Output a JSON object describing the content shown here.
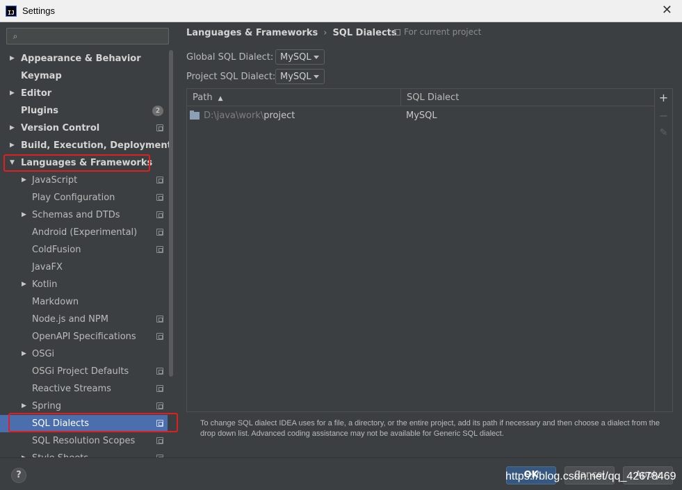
{
  "window": {
    "title": "Settings",
    "close_glyph": "✕",
    "app_icon_text": "IJ"
  },
  "search": {
    "placeholder": "",
    "value": "",
    "icon": "search-icon"
  },
  "tree": {
    "items": [
      {
        "label": "Appearance & Behavior",
        "level": 0,
        "arrow": "▶"
      },
      {
        "label": "Keymap",
        "level": 0,
        "arrow": ""
      },
      {
        "label": "Editor",
        "level": 0,
        "arrow": "▶"
      },
      {
        "label": "Plugins",
        "level": 0,
        "arrow": "",
        "badge": "2"
      },
      {
        "label": "Version Control",
        "level": 0,
        "arrow": "▶",
        "project": true
      },
      {
        "label": "Build, Execution, Deployment",
        "level": 0,
        "arrow": "▶"
      },
      {
        "label": "Languages & Frameworks",
        "level": 0,
        "arrow": "▼"
      },
      {
        "label": "JavaScript",
        "level": 1,
        "arrow": "▶",
        "project": true
      },
      {
        "label": "Play Configuration",
        "level": 1,
        "arrow": "",
        "project": true
      },
      {
        "label": "Schemas and DTDs",
        "level": 1,
        "arrow": "▶",
        "project": true
      },
      {
        "label": "Android (Experimental)",
        "level": 1,
        "arrow": "",
        "project": true
      },
      {
        "label": "ColdFusion",
        "level": 1,
        "arrow": "",
        "project": true
      },
      {
        "label": "JavaFX",
        "level": 1,
        "arrow": ""
      },
      {
        "label": "Kotlin",
        "level": 1,
        "arrow": "▶"
      },
      {
        "label": "Markdown",
        "level": 1,
        "arrow": ""
      },
      {
        "label": "Node.js and NPM",
        "level": 1,
        "arrow": "",
        "project": true
      },
      {
        "label": "OpenAPI Specifications",
        "level": 1,
        "arrow": "",
        "project": true
      },
      {
        "label": "OSGi",
        "level": 1,
        "arrow": "▶"
      },
      {
        "label": "OSGi Project Defaults",
        "level": 1,
        "arrow": "",
        "project": true
      },
      {
        "label": "Reactive Streams",
        "level": 1,
        "arrow": "",
        "project": true
      },
      {
        "label": "Spring",
        "level": 1,
        "arrow": "▶",
        "project": true
      },
      {
        "label": "SQL Dialects",
        "level": 1,
        "arrow": "",
        "project": true,
        "selected": true
      },
      {
        "label": "SQL Resolution Scopes",
        "level": 1,
        "arrow": "",
        "project": true
      },
      {
        "label": "Style Sheets",
        "level": 1,
        "arrow": "▶",
        "project": true
      }
    ]
  },
  "breadcrumb": {
    "parent": "Languages & Frameworks",
    "separator": "›",
    "current": "SQL Dialects"
  },
  "scope_note": "For current project",
  "global_dialect": {
    "label": "Global SQL Dialect:",
    "value": "MySQL"
  },
  "project_dialect": {
    "label": "Project SQL Dialect:",
    "value": "MySQL"
  },
  "table": {
    "columns": {
      "path": "Path",
      "dialect": "SQL Dialect",
      "sort_glyph": "▲"
    },
    "rows": [
      {
        "path_prefix": "D:\\java\\work\\",
        "path_name": "project",
        "dialect": "MySQL"
      }
    ]
  },
  "toolbar": {
    "add": "+",
    "remove": "−",
    "edit": "✎"
  },
  "hint": "To change SQL dialect IDEA uses for a file, a directory, or the entire project, add its path if necessary and then choose a dialect from the drop down list. Advanced coding assistance may not be available for Generic SQL dialect.",
  "footer": {
    "help": "?",
    "ok": "OK",
    "cancel": "Cancel",
    "apply": "Apply",
    "watermark": "https://blog.csdn.net/qq_42678469"
  },
  "colors": {
    "selection": "#4b6eaf",
    "highlight": "#e02020",
    "ok_button": "#365880",
    "background": "#3c3f41"
  }
}
